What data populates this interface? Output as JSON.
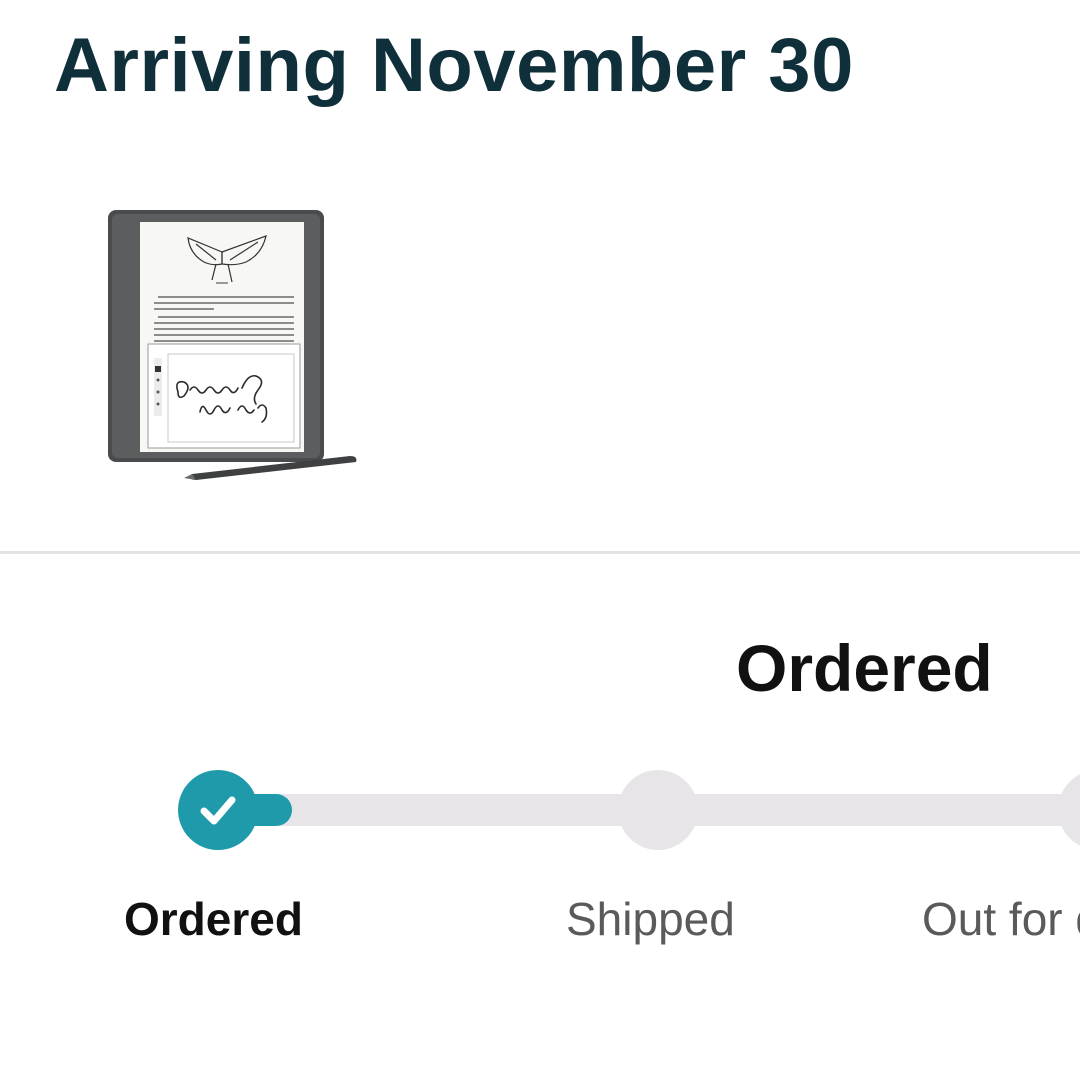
{
  "header": {
    "arrival_title": "Arriving November 30"
  },
  "product": {
    "image_icon": "kindle-scribe-with-pen"
  },
  "status": {
    "heading": "Ordered"
  },
  "tracker": {
    "progress_fraction": 0.0,
    "steps": [
      {
        "label": "Ordered",
        "state": "complete"
      },
      {
        "label": "Shipped",
        "state": "pending"
      },
      {
        "label": "Out for delivery",
        "state": "pending"
      }
    ]
  },
  "colors": {
    "title": "#0f2f3a",
    "accent": "#1f9aaa",
    "track": "#e7e5e8",
    "divider": "#e3e3e3"
  }
}
